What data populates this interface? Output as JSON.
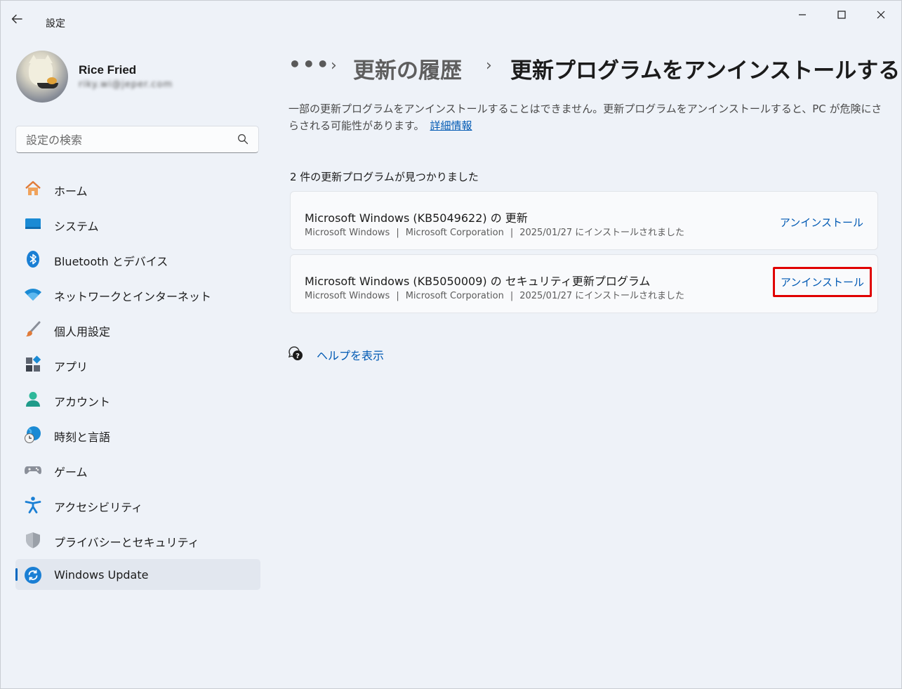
{
  "window": {
    "app_title": "設定",
    "controls": {
      "minimize": "—",
      "maximize": "",
      "close": "✕"
    }
  },
  "profile": {
    "name": "Rice Fried",
    "email": "riky.wi@jeper.com"
  },
  "search": {
    "placeholder": "設定の検索"
  },
  "sidebar": {
    "items": [
      {
        "label": "ホーム",
        "icon": "home-icon"
      },
      {
        "label": "システム",
        "icon": "system-icon"
      },
      {
        "label": "Bluetooth とデバイス",
        "icon": "bluetooth-icon"
      },
      {
        "label": "ネットワークとインターネット",
        "icon": "wifi-icon"
      },
      {
        "label": "個人用設定",
        "icon": "brush-icon"
      },
      {
        "label": "アプリ",
        "icon": "apps-icon"
      },
      {
        "label": "アカウント",
        "icon": "account-icon"
      },
      {
        "label": "時刻と言語",
        "icon": "globe-clock-icon"
      },
      {
        "label": "ゲーム",
        "icon": "gamepad-icon"
      },
      {
        "label": "アクセシビリティ",
        "icon": "accessibility-icon"
      },
      {
        "label": "プライバシーとセキュリティ",
        "icon": "shield-icon"
      },
      {
        "label": "Windows Update",
        "icon": "windows-update-icon",
        "selected": true
      }
    ]
  },
  "breadcrumb": {
    "more": "•••",
    "separator": "›",
    "previous": "更新の履歴",
    "current": "更新プログラムをアンインストールする"
  },
  "description": {
    "text": "一部の更新プログラムをアンインストールすることはできません。更新プログラムをアンインストールすると、PC が危険にさらされる可能性があります。",
    "link": "詳細情報"
  },
  "updates": {
    "count_label": "2 件の更新プログラムが見つかりました",
    "items": [
      {
        "title": "Microsoft Windows (KB5049622) の 更新",
        "product": "Microsoft Windows",
        "publisher": "Microsoft Corporation",
        "installed": "2025/01/27 にインストールされました",
        "action": "アンインストール"
      },
      {
        "title": "Microsoft Windows (KB5050009) の セキュリティ更新プログラム",
        "product": "Microsoft Windows",
        "publisher": "Microsoft Corporation",
        "installed": "2025/01/27 にインストールされました",
        "action": "アンインストール"
      }
    ],
    "meta_separator": "|"
  },
  "help": {
    "label": "ヘルプを表示"
  },
  "colors": {
    "accent": "#0059b3",
    "highlight_box": "#e00000",
    "background": "#eef2f8"
  }
}
